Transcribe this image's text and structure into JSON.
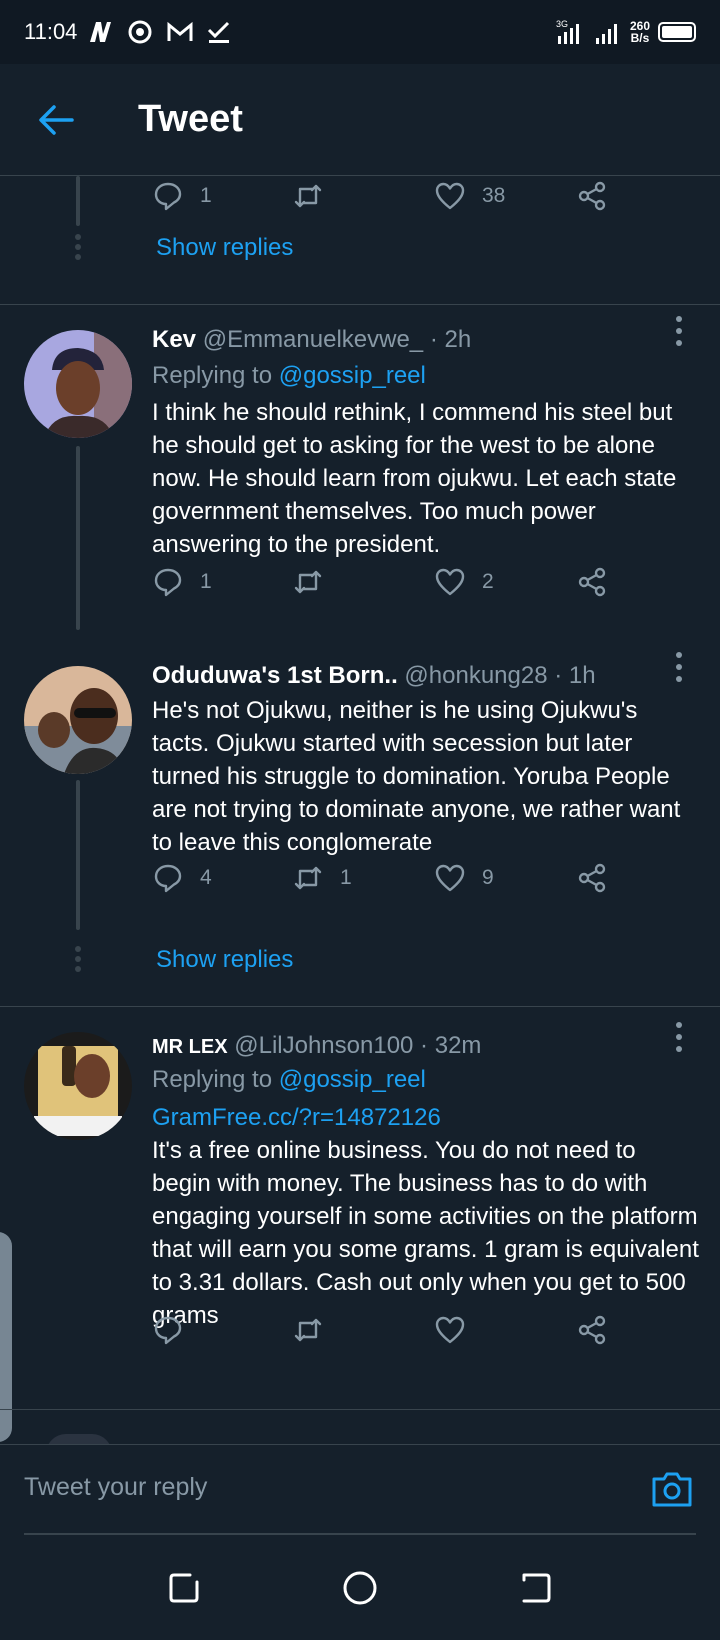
{
  "status": {
    "time": "11:04",
    "net_speed_value": "260",
    "net_speed_unit": "B/s",
    "network": "3G"
  },
  "header": {
    "title": "Tweet",
    "back_label": "back"
  },
  "top_actions": {
    "reply": "1",
    "retweet": "",
    "like": "38"
  },
  "show_replies_1": "Show replies",
  "tweets": [
    {
      "name": "Kev",
      "meta": "@Emmanuelkevwe_ · 2h",
      "replying_prefix": "Replying to ",
      "replying_handle": "@gossip_reel",
      "body": "I think he should rethink, I commend his steel but he should get to asking for the west to be alone now. He should learn from ojukwu. Let each state government themselves. Too much power answering to the president.",
      "reply": "1",
      "retweet": "",
      "like": "2"
    },
    {
      "name": "Oduduwa's 1st Born..",
      "meta": "@honkung28 · 1h",
      "body": "He's not Ojukwu, neither is he using Ojukwu's tacts. Ojukwu started with secession but later turned his struggle to domination. Yoruba People are not trying to dominate anyone, we rather want to leave this conglomerate",
      "reply": "4",
      "retweet": "1",
      "like": "9"
    },
    {
      "name": "MR LEX",
      "meta": "@LilJohnson100 · 32m",
      "replying_prefix": "Replying to ",
      "replying_handle": "@gossip_reel",
      "link": "GramFree.cc/?r=14872126",
      "body": "It's a free online business. You do not need to begin with money. The business has to do with engaging yourself in some activities on the platform that will earn you some grams. 1 gram is equivalent to 3.31 dollars. Cash out only when you get to 500 grams",
      "reply": "",
      "retweet": "",
      "like": ""
    }
  ],
  "show_replies_2": "Show replies",
  "reply_bar": {
    "placeholder": "Tweet your reply"
  },
  "colors": {
    "background": "#15202b",
    "accent": "#1da1f2",
    "muted": "#8899a6",
    "border": "#38444d"
  }
}
